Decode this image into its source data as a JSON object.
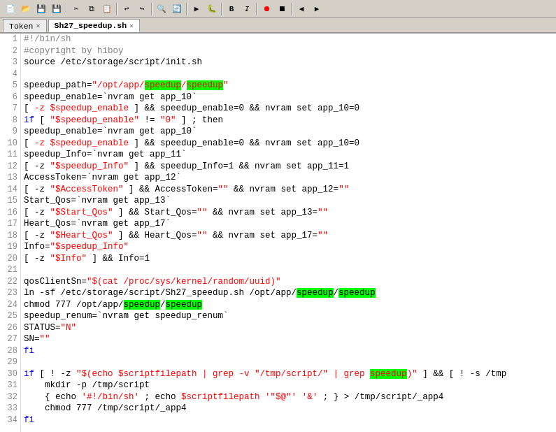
{
  "toolbar": {
    "buttons": [
      "new",
      "open",
      "save",
      "saveall",
      "sep1",
      "cut",
      "copy",
      "paste",
      "sep2",
      "undo",
      "redo",
      "sep3",
      "find",
      "replace",
      "sep4",
      "run",
      "debug",
      "sep5",
      "bold",
      "italic",
      "sep6",
      "record",
      "stop",
      "sep7",
      "prev",
      "next"
    ]
  },
  "tabs": [
    {
      "label": "Token",
      "active": false
    },
    {
      "label": "Sh27_speedup.sh",
      "active": true
    }
  ],
  "lines": [
    {
      "num": 1,
      "html": "<span class='c-shebang'>#!/bin/sh</span>"
    },
    {
      "num": 2,
      "html": "<span class='c-comment'>#copyright by hiboy</span>"
    },
    {
      "num": 3,
      "html": "<span class='c-default'>source /etc/storage/script/init.sh</span>"
    },
    {
      "num": 4,
      "html": ""
    },
    {
      "num": 5,
      "html": "<span class='c-default'>speedup_path=<span class='c-string'>\"/opt/app/<span class='hl-green'>speedup</span>/<span class='hl-green'>speedup</span>\"</span></span>"
    },
    {
      "num": 6,
      "html": "<span class='c-default'>speedup_enable=`nvram get app_10`</span>"
    },
    {
      "num": 7,
      "html": "<span class='c-default'>[ <span class='c-var'>-z $speedup_enable</span> ] &amp;&amp; speedup_enable=0 &amp;&amp; nvram set app_10=0</span>"
    },
    {
      "num": 8,
      "html": "<span class='c-kw'>if</span><span class='c-default'> [ <span class='c-string'>\"$speedup_enable\"</span> != <span class='c-string'>\"0\"</span> ] ; then</span>"
    },
    {
      "num": 9,
      "html": "<span class='c-default'>speedup_enable=`nvram get app_10`</span>"
    },
    {
      "num": 10,
      "html": "<span class='c-default'>[ <span class='c-var'>-z $speedup_enable</span> ] &amp;&amp; speedup_enable=0 &amp;&amp; nvram set app_10=0</span>"
    },
    {
      "num": 11,
      "html": "<span class='c-default'>speedup_Info=`nvram get app_11`</span>"
    },
    {
      "num": 12,
      "html": "<span class='c-default'>[ -z <span class='c-string'>\"$speedup_Info\"</span> ] &amp;&amp; speedup_Info=1 &amp;&amp; nvram set app_11=1</span>"
    },
    {
      "num": 13,
      "html": "<span class='c-default'>AccessToken=`nvram get app_12`</span>"
    },
    {
      "num": 14,
      "html": "<span class='c-default'>[ -z <span class='c-string'>\"$AccessToken\"</span> ] &amp;&amp; AccessToken=<span class='c-string'>\"\"</span> &amp;&amp; nvram set app_12=<span class='c-string'>\"\"</span></span>"
    },
    {
      "num": 15,
      "html": "<span class='c-default'>Start_Qos=`nvram get app_13`</span>"
    },
    {
      "num": 16,
      "html": "<span class='c-default'>[ -z <span class='c-string'>\"$Start_Qos\"</span> ] &amp;&amp; Start_Qos=<span class='c-string'>\"\"</span> &amp;&amp; nvram set app_13=<span class='c-string'>\"\"</span></span>"
    },
    {
      "num": 17,
      "html": "<span class='c-default'>Heart_Qos=`nvram get app_17`</span>"
    },
    {
      "num": 18,
      "html": "<span class='c-default'>[ -z <span class='c-string'>\"$Heart_Qos\"</span> ] &amp;&amp; Heart_Qos=<span class='c-string'>\"\"</span> &amp;&amp; nvram set app_17=<span class='c-string'>\"\"</span></span>"
    },
    {
      "num": 19,
      "html": "<span class='c-default'>Info=<span class='c-string'>\"$speedup_Info\"</span></span>"
    },
    {
      "num": 20,
      "html": "<span class='c-default'>[ -z <span class='c-string'>\"$Info\"</span> ] &amp;&amp; Info=1</span>"
    },
    {
      "num": 21,
      "html": ""
    },
    {
      "num": 22,
      "html": "<span class='c-default'>qosClientSn=<span class='c-string'>\"$(cat /proc/sys/kernel/random/uuid)\"</span></span>"
    },
    {
      "num": 23,
      "html": "<span class='c-default'>ln -sf /etc/storage/script/Sh27_speedup.sh /opt/app/<span class='hl-green'>speedup</span>/<span class='hl-green'>speedup</span></span>"
    },
    {
      "num": 24,
      "html": "<span class='c-default'>chmod 777 /opt/app/<span class='hl-green'>speedup</span>/<span class='hl-green'>speedup</span></span>"
    },
    {
      "num": 25,
      "html": "<span class='c-default'>speedup_renum=`nvram get speedup_renum`</span>"
    },
    {
      "num": 26,
      "html": "<span class='c-default'>STATUS=<span class='c-string'>\"N\"</span></span>"
    },
    {
      "num": 27,
      "html": "<span class='c-default'>SN=<span class='c-string'>\"\"</span></span>"
    },
    {
      "num": 28,
      "html": "<span class='c-kw'>fi</span>"
    },
    {
      "num": 29,
      "html": ""
    },
    {
      "num": 30,
      "html": "<span class='c-kw'>if</span><span class='c-default'> [ ! -z <span class='c-string'>\"$(echo $scriptfilepath | grep -v \"/tmp/script/\" | grep <span class='hl-green'>speedup</span>)\"</span> ] &amp;&amp; [ ! -s /tmp</span>"
    },
    {
      "num": 31,
      "html": "<span class='c-default'>    mkdir -p /tmp/script</span>"
    },
    {
      "num": 32,
      "html": "<span class='c-default'>    { echo <span class='c-string'>'#!/bin/sh'</span> ; echo <span class='c-var'>$scriptfilepath</span> <span class='c-string'>'\"$@\"'</span> <span class='c-string'>'&amp;'</span> ; } &gt; /tmp/script/_app4</span>"
    },
    {
      "num": 33,
      "html": "<span class='c-default'>    chmod 777 /tmp/script/_app4</span>"
    },
    {
      "num": 34,
      "html": "<span class='c-kw'>fi</span>"
    }
  ]
}
